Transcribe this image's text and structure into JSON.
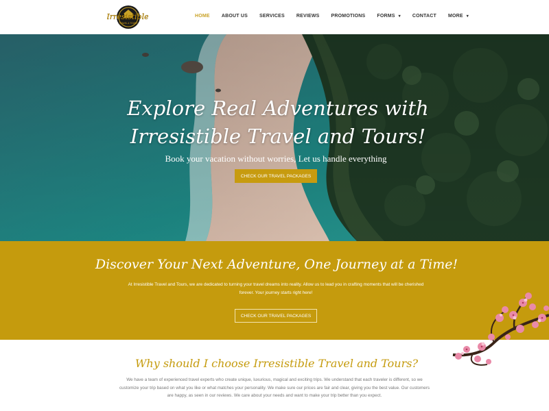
{
  "logo": {
    "brand_text": "Irresistible",
    "sub_text": "TRAVEL & TOURS"
  },
  "nav": {
    "items": [
      {
        "label": "HOME",
        "active": true
      },
      {
        "label": "ABOUT US"
      },
      {
        "label": "SERVICES"
      },
      {
        "label": "REVIEWS"
      },
      {
        "label": "PROMOTIONS"
      },
      {
        "label": "FORMS",
        "has_dropdown": true
      },
      {
        "label": "CONTACT"
      },
      {
        "label": "MORE",
        "has_dropdown": true
      }
    ],
    "caret_icon": "▾"
  },
  "hero": {
    "title_line1": "Explore Real Adventures with",
    "title_line2": "Irresistible Travel and Tours!",
    "subtitle": "Book your vacation without worries, Let us handle everything",
    "button_label": "CHECK OUR TRAVEL PACKAGES",
    "image": "aerial-beach-coastline"
  },
  "discover": {
    "title": "Discover Your Next Adventure, One Journey at a Time!",
    "text": "At Irresistible Travel and Tours, we are dedicated to turning your travel dreams into reality. Allow us to lead you in crafting moments that will be cherished forever. Your journey starts right here!",
    "button_label": "CHECK OUR TRAVEL PACKAGES",
    "decoration": "cherry-blossom-branch"
  },
  "why": {
    "title": "Why should I choose Irresistible Travel and Tours?",
    "text": "We have a team of experienced travel experts who create unique, luxurious, magical and exciting trips. We understand that each traveler is different, so we customize your trip based on what you like or what matches your personality. We make sure our prices are fair and clear, giving you the best value. Our customers are happy, as seen in our reviews. We care about your needs and want to make your trip better than you expect."
  },
  "colors": {
    "accent_gold": "#c59b0d",
    "nav_active": "#c9a227",
    "sea": "#1f7a78",
    "sand": "#d8b8a4",
    "forest": "#1f3a25"
  }
}
